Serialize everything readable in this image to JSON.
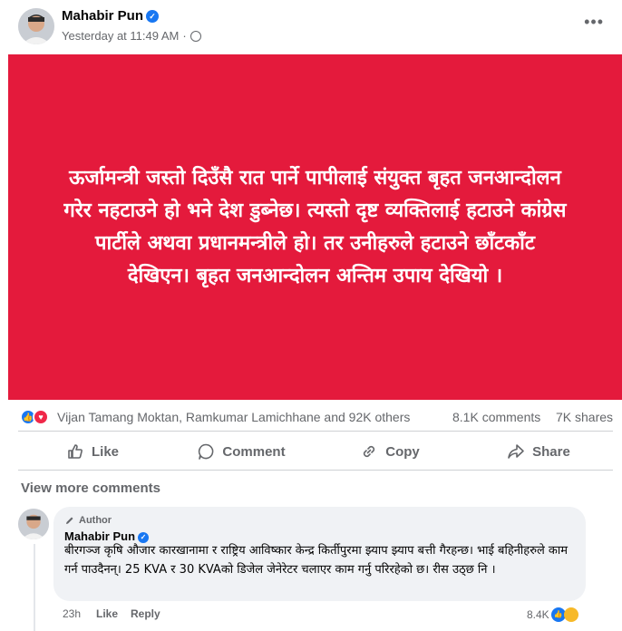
{
  "post": {
    "author_name": "Mahabir Pun",
    "timestamp": "Yesterday at 11:49 AM",
    "separator": "·",
    "more_label": "•••",
    "text": "ऊर्जामन्त्री जस्तो दिउँसै रात पार्ने पापीलाई संयुक्त बृहत जनआन्दोलन गरेर नहटाउने हो भने देश डुब्नेछ। त्यस्तो दृष्ट व्यक्तिलाई हटाउने कांग्रेस पार्टीले अथवा प्रधानमन्त्रीले हो। तर उनीहरुले हटाउने छाँटकाँट देखिएन। बृहत जनआन्दोलन अन्तिम उपाय देखियो ।",
    "card_color": "#e41a3c"
  },
  "reactions": {
    "names": "Vijan Tamang Moktan, Ramkumar Lamichhane and 92K others",
    "comments": "8.1K comments",
    "shares": "7K shares"
  },
  "actions": {
    "like": "Like",
    "comment": "Comment",
    "copy": "Copy",
    "share": "Share"
  },
  "view_more_comments": "View more comments",
  "comment": {
    "badge": "Author",
    "name": "Mahabir Pun",
    "text": "बीरगञ्ज कृषि औजार कारखानामा र राष्ट्रिय आविष्कार केन्द्र किर्तीपुरमा झ्याप झ्याप बत्ती गैरहन्छ। भाई बहिनीहरुले काम गर्न पाउदैनन्। 25 KVA र 30 KVAको डिजेल जेनेरेटर चलाएर काम गर्नु परिरहेको छ। रीस उठ्छ नि ।",
    "time": "23h",
    "like": "Like",
    "reply": "Reply",
    "reaction_count": "8.4K"
  },
  "icons": {
    "verified": "verified-badge-icon",
    "globe": "globe-icon",
    "like_reaction": "like-reaction-icon",
    "love_reaction": "love-reaction-icon",
    "sad_reaction": "sad-reaction-icon"
  }
}
